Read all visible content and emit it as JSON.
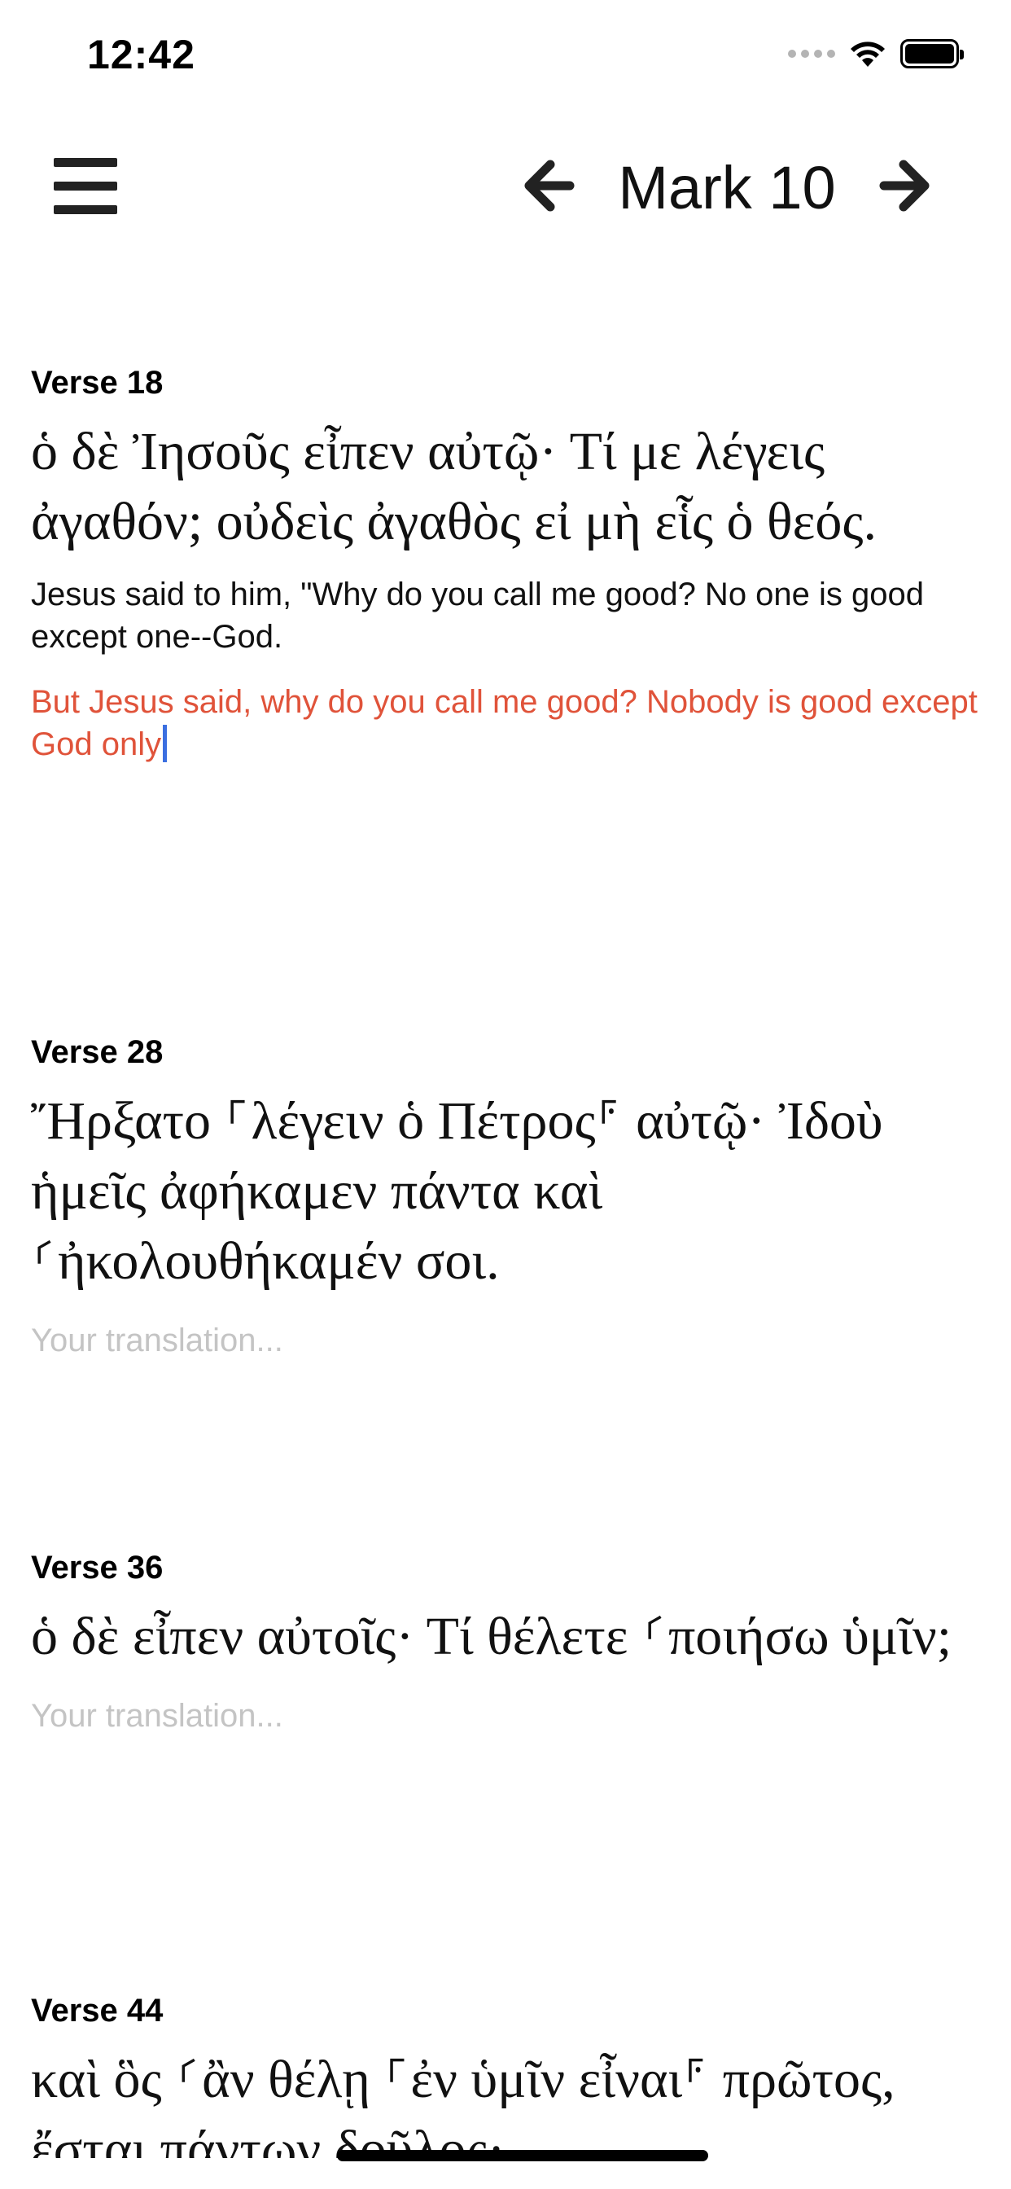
{
  "status_bar": {
    "time": "12:42",
    "icons": [
      "signal-dots",
      "wifi-icon",
      "battery-icon"
    ]
  },
  "nav": {
    "menu_icon": "hamburger-menu-icon",
    "prev_icon": "arrow-left-icon",
    "title": "Mark 10",
    "next_icon": "arrow-right-icon"
  },
  "verses": [
    {
      "label": "Verse 18",
      "greek": "ὁ δὲ Ἰησοῦς εἶπεν αὐτῷ· Τί με λέγεις ἀγαθόν; οὐδεὶς ἀγαθὸς εἰ μὴ εἷς ὁ θεός.",
      "english": "Jesus said to him, \"Why do you call me good? No one is good except one--God.",
      "translation": "But Jesus said, why do you call me good? Nobody is good except God only"
    },
    {
      "label": "Verse 28",
      "greek": "Ἤρξατο ⸀λέγειν ὁ Πέτρος⸁ αὐτῷ· Ἰδοὺ ἡμεῖς ἀφήκαμεν πάντα καὶ ⸂ἠκολουθήκαμέν σοι.",
      "translation_placeholder": "Your translation..."
    },
    {
      "label": "Verse 36",
      "greek": "ὁ δὲ εἶπεν αὐτοῖς· Τί θέλετε ⸂ποιήσω ὑμῖν;",
      "translation_placeholder": "Your translation..."
    },
    {
      "label": "Verse 44",
      "greek": "καὶ ὃς ⸂ἂν θέλῃ ⸀ἐν ὑμῖν εἶναι⸁ πρῶτος, ἔσται πάντων δοῦλος·"
    }
  ],
  "colors": {
    "translation_text": "#e0533a",
    "placeholder_text": "#c4c4c4",
    "cursor": "#3b6fe0"
  }
}
